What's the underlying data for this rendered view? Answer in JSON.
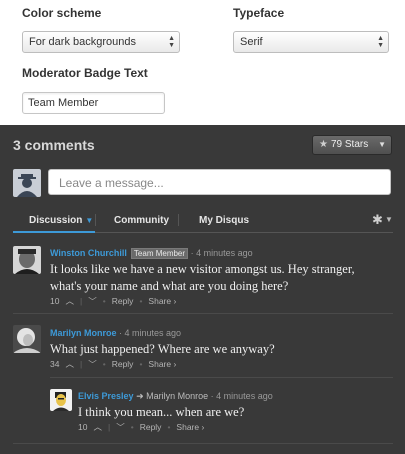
{
  "settings": {
    "color_scheme": {
      "label": "Color scheme",
      "value": "For dark backgrounds"
    },
    "typeface": {
      "label": "Typeface",
      "value": "Serif"
    },
    "badge_text": {
      "label": "Moderator Badge Text",
      "value": "Team Member"
    }
  },
  "widget": {
    "comment_count": "3 comments",
    "stars_label": "79 Stars",
    "compose_placeholder": "Leave a message...",
    "tabs": [
      {
        "label": "Discussion"
      },
      {
        "label": "Community"
      },
      {
        "label": "My Disqus"
      }
    ],
    "comments": [
      {
        "author": "Winston Churchill",
        "badge": "Team Member",
        "time": "4 minutes ago",
        "text_line1": "It looks like we have a new visitor amongst us. Hey stranger,",
        "text_line2": "what's your name and what are you doing here?",
        "votes": "10",
        "reply": "Reply",
        "share": "Share ›"
      },
      {
        "author": "Marilyn Monroe",
        "time": "4 minutes ago",
        "text_line1": "What just happened? Where are we anyway?",
        "votes": "34",
        "reply": "Reply",
        "share": "Share ›"
      },
      {
        "author": "Elvis Presley",
        "reply_arrow": "➜",
        "reply_to": "Marilyn Monroe",
        "time": "4 minutes ago",
        "text_line1": "I think you mean... when are we?",
        "votes": "10",
        "reply": "Reply",
        "share": "Share ›"
      }
    ]
  },
  "colors": {
    "accent": "#3d9ad8",
    "widget_bg": "#393939"
  },
  "icons": {
    "star": "star-icon",
    "gear": "gear-icon",
    "upvote": "chevron-up-icon",
    "downvote": "chevron-down-icon"
  }
}
